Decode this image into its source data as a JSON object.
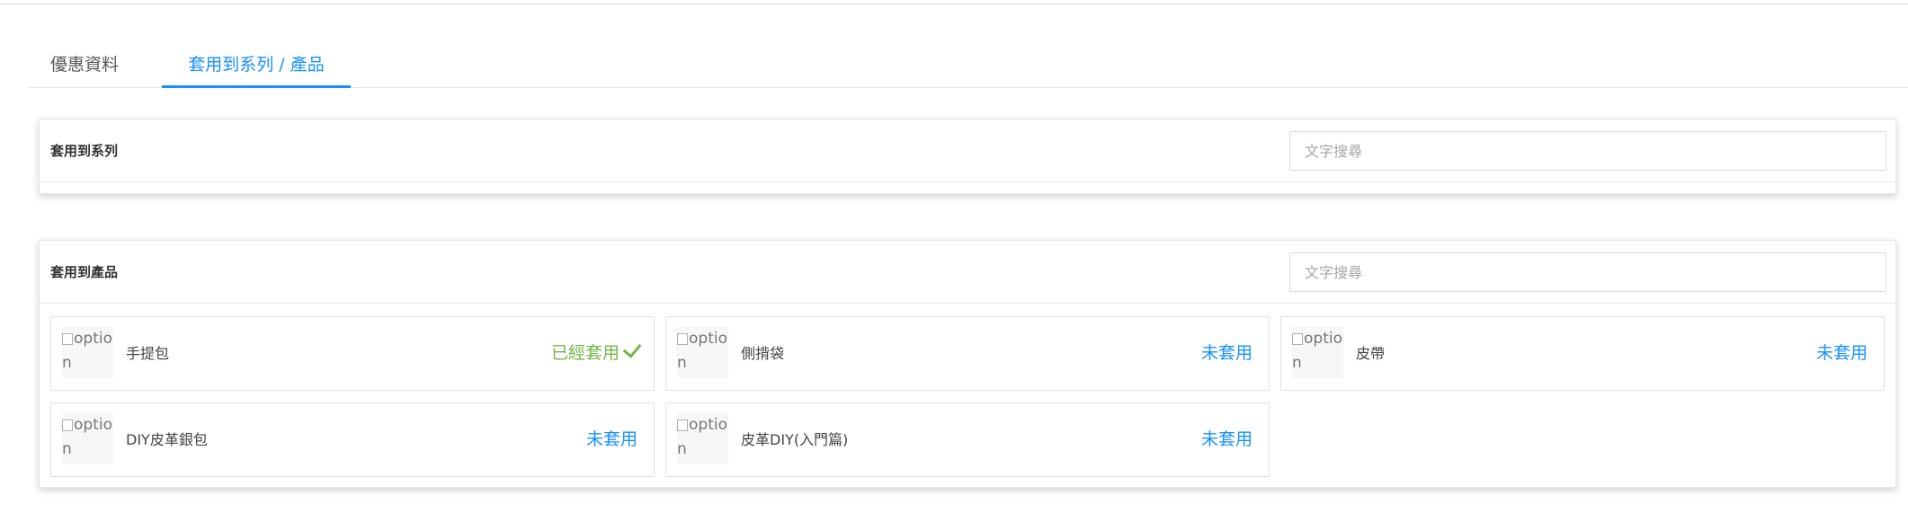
{
  "tabs": [
    {
      "label": "優惠資料"
    },
    {
      "label": "套用到系列 / 產品"
    }
  ],
  "series_card": {
    "title": "套用到系列",
    "search_placeholder": "文字搜尋"
  },
  "products_card": {
    "title": "套用到產品",
    "search_placeholder": "文字搜尋",
    "thumb_alt": "option",
    "items": [
      {
        "name": "手提包",
        "status": "已經套用",
        "applied": true,
        "icon": "check-icon"
      },
      {
        "name": "側揹袋",
        "status": "未套用",
        "applied": false
      },
      {
        "name": "皮帶",
        "status": "未套用",
        "applied": false
      },
      {
        "name": "DIY皮革銀包",
        "status": "未套用",
        "applied": false
      },
      {
        "name": "皮革DIY(入門篇)",
        "status": "未套用",
        "applied": false
      }
    ]
  },
  "colors": {
    "accent": "#1890ff",
    "applied": "#72b64a",
    "border": "#e8e8e8"
  }
}
